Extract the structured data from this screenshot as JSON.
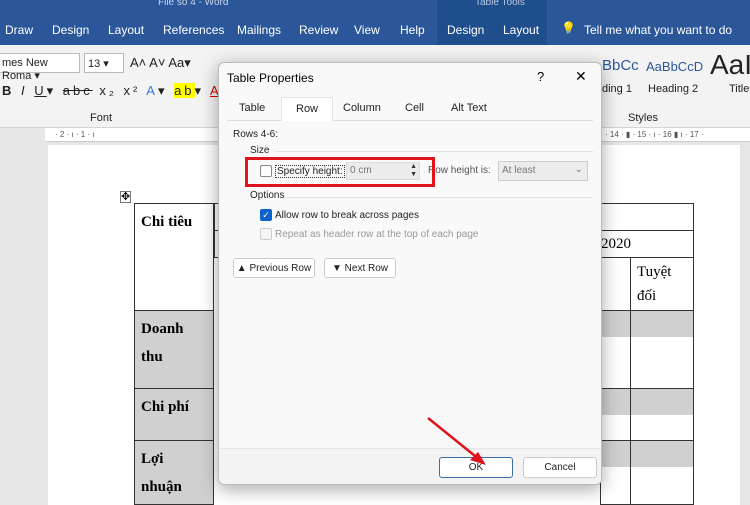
{
  "window": {
    "title": "File so 4 - Word",
    "context_title": "Table Tools"
  },
  "ribbon_tabs": [
    "Draw",
    "Design",
    "Layout",
    "References",
    "Mailings",
    "Review",
    "View",
    "Help",
    "Design",
    "Layout"
  ],
  "tell_me": "Tell me what you want to do",
  "font": {
    "name": "mes New Roma",
    "size": "13",
    "group_label": "Font"
  },
  "styles": {
    "items": [
      "BbCc",
      "AaBbCcD",
      "AaI"
    ],
    "labels": [
      "ding 1",
      "Heading 2",
      "Title"
    ],
    "group_label": "Styles"
  },
  "ruler": {
    "left": "· 2 · ı · 1 · ı",
    "right": "· 14 · ▮ · 15 · ı · 16 ▮ ı · 17 ·"
  },
  "table": {
    "header": "Chi tiêu",
    "year": "2020",
    "col_partial": "(",
    "col_partial2": "%)",
    "abs": "Tuyệt đối",
    "rows": [
      "Doanh thu",
      "Chi phí",
      "Lợi nhuận"
    ]
  },
  "dialog": {
    "title": "Table Properties",
    "help": "?",
    "close": "✕",
    "tabs": [
      "Table",
      "Row",
      "Column",
      "Cell",
      "Alt Text"
    ],
    "active_tab": "Row",
    "rows_label": "Rows 4-6:",
    "size_label": "Size",
    "specify_height": {
      "label": "Specify height:",
      "checked": false,
      "value": "0 cm"
    },
    "row_height_is": {
      "label": "Row height is:",
      "label_visible": "ow height is:",
      "value": "At least"
    },
    "options_label": "Options",
    "allow_break": {
      "label": "Allow row to break across pages",
      "checked": true
    },
    "repeat_header": {
      "label": "Repeat as header row at the top of each page",
      "checked": false,
      "disabled": true
    },
    "prev_row": "Previous Row",
    "next_row": "Next Row",
    "ok": "OK",
    "cancel": "Cancel"
  },
  "colors": {
    "word_blue": "#2b579a",
    "highlight_red": "#e0121b",
    "check_blue": "#0f62c9"
  }
}
